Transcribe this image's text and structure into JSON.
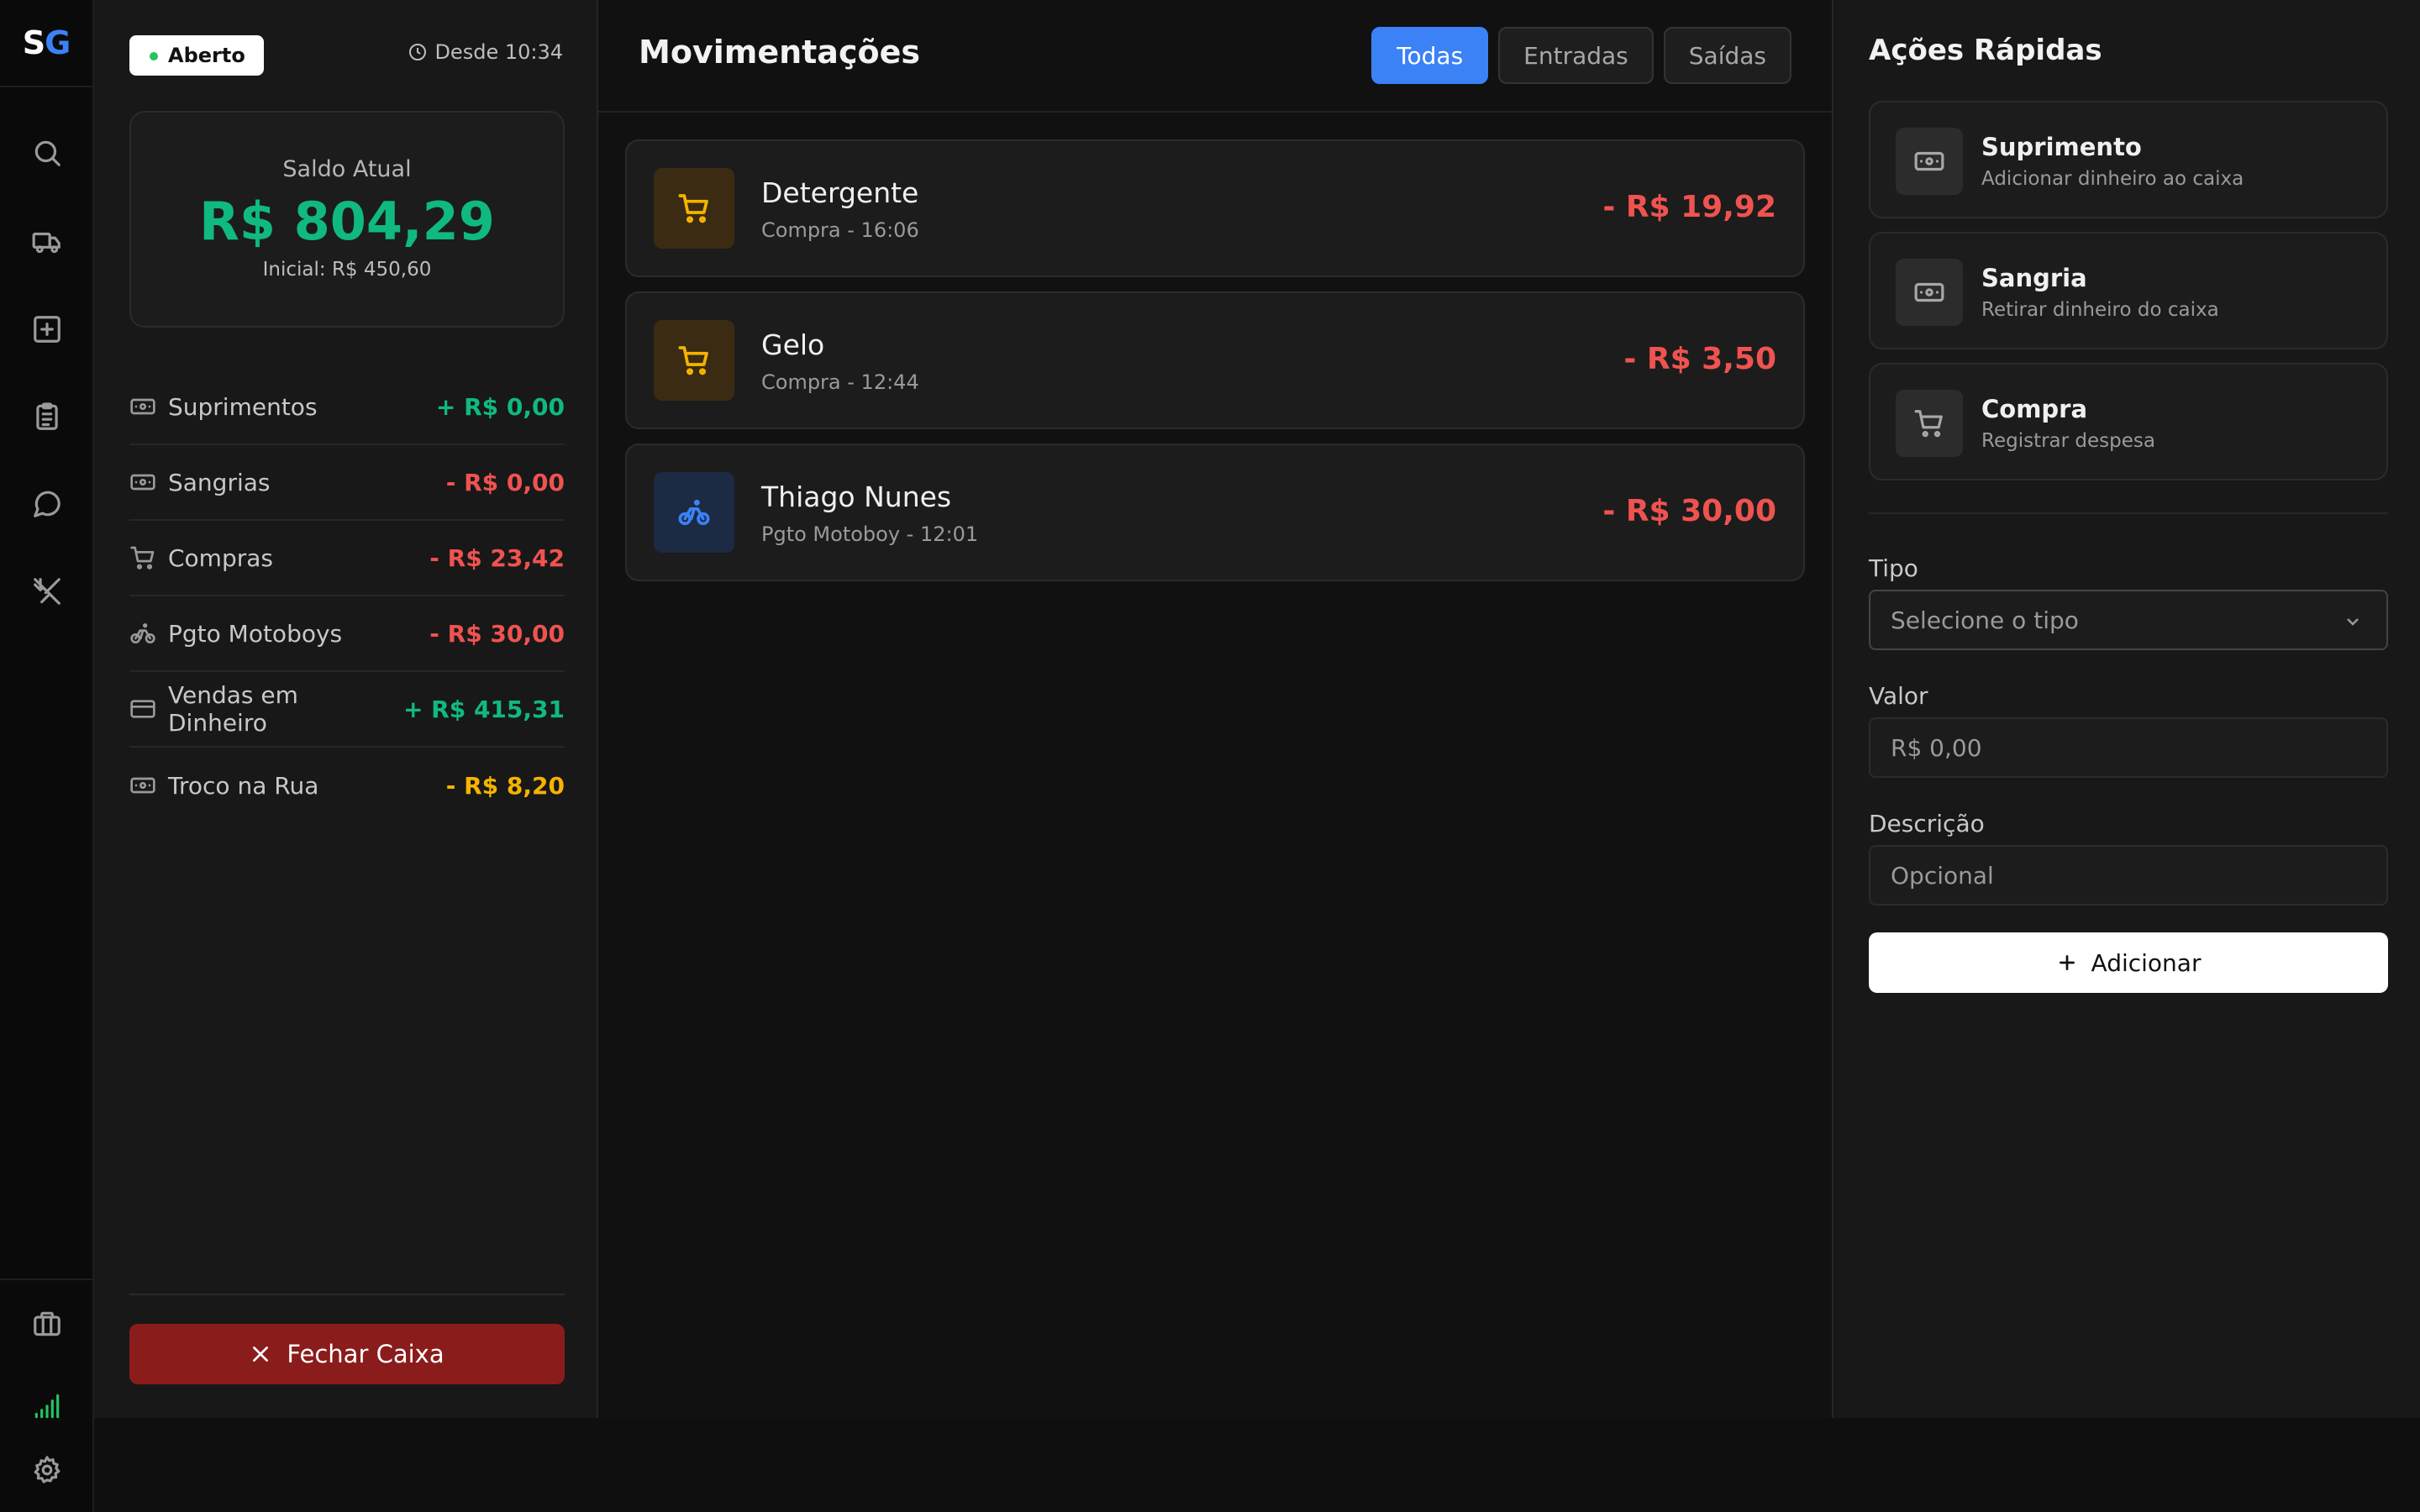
{
  "logo": {
    "s": "S",
    "g": "G"
  },
  "rail": {
    "icons": [
      "search-icon",
      "truck-icon",
      "plus-square-icon",
      "clipboard-icon",
      "chat-icon",
      "utensils-icon"
    ],
    "bottom_icons": [
      "briefcase-icon",
      "signal-icon",
      "gear-icon"
    ],
    "signal_color": "#22c55e"
  },
  "register": {
    "status": "Aberto",
    "since": "Desde 10:34",
    "balance_label": "Saldo Atual",
    "balance_value": "R$ 804,29",
    "initial": "Inicial: R$ 450,60",
    "summary": [
      {
        "label": "Suprimentos",
        "value": "+ R$ 0,00",
        "color": "green",
        "icon": "cash-icon"
      },
      {
        "label": "Sangrias",
        "value": "- R$ 0,00",
        "color": "red",
        "icon": "cash-icon"
      },
      {
        "label": "Compras",
        "value": "- R$ 23,42",
        "color": "red",
        "icon": "cart-icon"
      },
      {
        "label": "Pgto Motoboys",
        "value": "- R$ 30,00",
        "color": "red",
        "icon": "bike-icon"
      },
      {
        "label": "Vendas em Dinheiro",
        "value": "+ R$ 415,31",
        "color": "green",
        "icon": "card-icon"
      },
      {
        "label": "Troco na Rua",
        "value": "- R$ 8,20",
        "color": "amber",
        "icon": "cash-icon"
      }
    ],
    "close_label": "Fechar Caixa"
  },
  "movements": {
    "title": "Movimentações",
    "filters": [
      "Todas",
      "Entradas",
      "Saídas"
    ],
    "active_filter": "Todas",
    "items": [
      {
        "name": "Detergente",
        "sub": "Compra - 16:06",
        "value": "- R$ 19,92",
        "kind": "cart"
      },
      {
        "name": "Gelo",
        "sub": "Compra - 12:44",
        "value": "- R$ 3,50",
        "kind": "cart"
      },
      {
        "name": "Thiago Nunes",
        "sub": "Pgto Motoboy - 12:01",
        "value": "- R$ 30,00",
        "kind": "bike"
      }
    ]
  },
  "quick_actions": {
    "title": "Ações Rápidas",
    "items": [
      {
        "title": "Suprimento",
        "sub": "Adicionar dinheiro ao caixa",
        "icon": "cash-icon"
      },
      {
        "title": "Sangria",
        "sub": "Retirar dinheiro do caixa",
        "icon": "cash-icon"
      },
      {
        "title": "Compra",
        "sub": "Registrar despesa",
        "icon": "cart-icon"
      }
    ],
    "form": {
      "type_label": "Tipo",
      "type_placeholder": "Selecione o tipo",
      "value_label": "Valor",
      "value_placeholder": "R$ 0,00",
      "desc_label": "Descrição",
      "desc_placeholder": "Opcional",
      "submit_label": "Adicionar"
    }
  },
  "colors": {
    "accent": "#3b82f6",
    "positive": "#10b981",
    "negative": "#ef5350",
    "warning": "#f5b301",
    "danger_button": "#8b1c1c"
  }
}
